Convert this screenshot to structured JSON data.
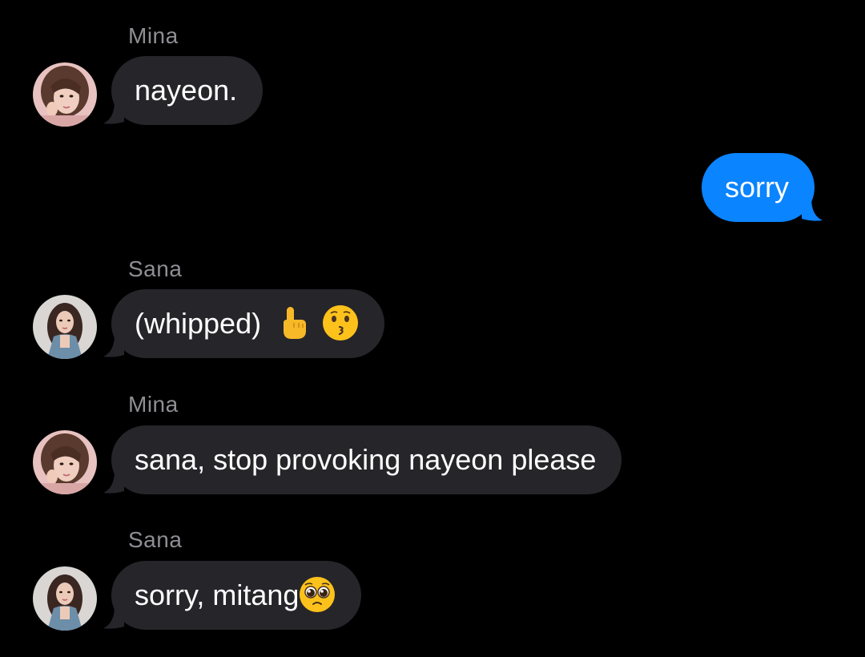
{
  "colors": {
    "background": "#000000",
    "incoming_bubble": "#26252a",
    "outgoing_bubble": "#0a84ff",
    "sender_text": "#8e8e93",
    "message_text": "#ffffff"
  },
  "messages": [
    {
      "sender": "Mina",
      "avatar": "mina-avatar",
      "text": "nayeon.",
      "direction": "incoming"
    },
    {
      "sender": "",
      "text": "sorry",
      "direction": "outgoing"
    },
    {
      "sender": "Sana",
      "avatar": "sana-avatar",
      "text": "(whipped)",
      "emojis": [
        "pointing-up-emoji",
        "kissing-face-emoji"
      ],
      "direction": "incoming"
    },
    {
      "sender": "Mina",
      "avatar": "mina-avatar",
      "text": "sana, stop provoking nayeon please",
      "direction": "incoming"
    },
    {
      "sender": "Sana",
      "avatar": "sana-avatar",
      "text": "sorry, mitang",
      "emojis": [
        "pleading-face-emoji"
      ],
      "direction": "incoming"
    }
  ]
}
